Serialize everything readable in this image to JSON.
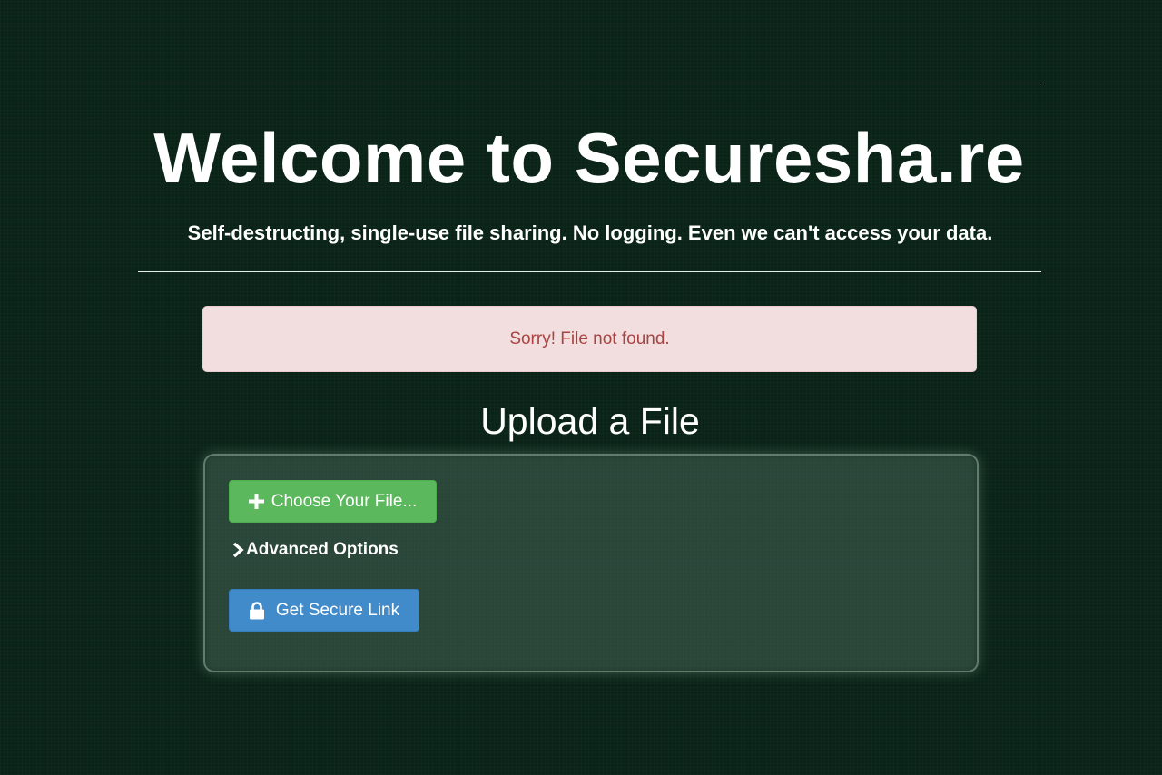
{
  "header": {
    "title": "Welcome to Securesha.re",
    "subtitle": "Self-destructing, single-use file sharing. No logging. Even we can't access your data."
  },
  "alert": {
    "message": "Sorry! File not found."
  },
  "upload": {
    "heading": "Upload a File",
    "choose_file_label": "Choose Your File...",
    "choose_file_icon": "plus-icon",
    "advanced_options_label": "Advanced Options",
    "advanced_options_icon": "chevron-right-icon",
    "get_link_label": "Get Secure Link",
    "get_link_icon": "lock-icon"
  },
  "colors": {
    "background": "#0a2317",
    "alert_bg": "#f2dede",
    "alert_text": "#a94442",
    "success_button": "#5cb85c",
    "primary_button": "#428bca"
  }
}
